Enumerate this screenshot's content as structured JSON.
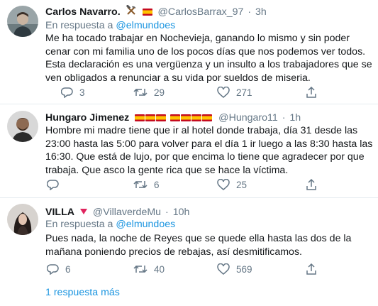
{
  "tweets": [
    {
      "name": "Carlos Navarro.",
      "handle": "@CarlosBarrax_97",
      "time": "3h",
      "reply_label": "En respuesta a",
      "reply_mention": "@elmundoes",
      "lines": [
        "Me ha tocado trabajar en Nochevieja, ganando lo mismo y sin poder",
        "cenar con mi familia uno de los pocos días que nos podemos ver todos.",
        "Esta declaración es una vergüenza y un insulto a los trabajadores que se",
        "ven obligados a renunciar a su vida por sueldos de miseria."
      ],
      "replies": "3",
      "retweets": "29",
      "likes": "271"
    },
    {
      "name": "Hungaro Jimenez",
      "handle": "@Hungaro11",
      "time": "1h",
      "lines": [
        "Hombre mi madre tiene que ir al hotel donde trabaja, día 31 desde las",
        "23:00 hasta las 5:00 para volver para el día 1 ir luego a las 8:30 hasta las",
        "16:30. Que está de lujo, por que encima lo tiene que agradecer por que",
        "trabaja. Que asco la gente rica que se hace la víctima."
      ],
      "replies": "",
      "retweets": "6",
      "likes": "25"
    },
    {
      "name": "VILLA",
      "handle": "@VillaverdeMu",
      "time": "10h",
      "reply_label": "En respuesta a",
      "reply_mention": "@elmundoes",
      "lines": [
        "Pues nada, la noche de Reyes que se quede ella hasta las dos de la",
        "mañana poniendo precios de rebajas,  así desmitificamos."
      ],
      "replies": "6",
      "retweets": "40",
      "likes": "569"
    }
  ],
  "more_replies": "1 respuesta más",
  "colors": {
    "link": "#1b95e0",
    "muted": "#657786",
    "text": "#14171a",
    "divider": "#e6ecf0"
  },
  "icons": [
    "reply-icon",
    "retweet-icon",
    "like-icon",
    "share-icon",
    "hammer-pick-icon",
    "spain-flag-icon",
    "red-triangle-icon"
  ]
}
